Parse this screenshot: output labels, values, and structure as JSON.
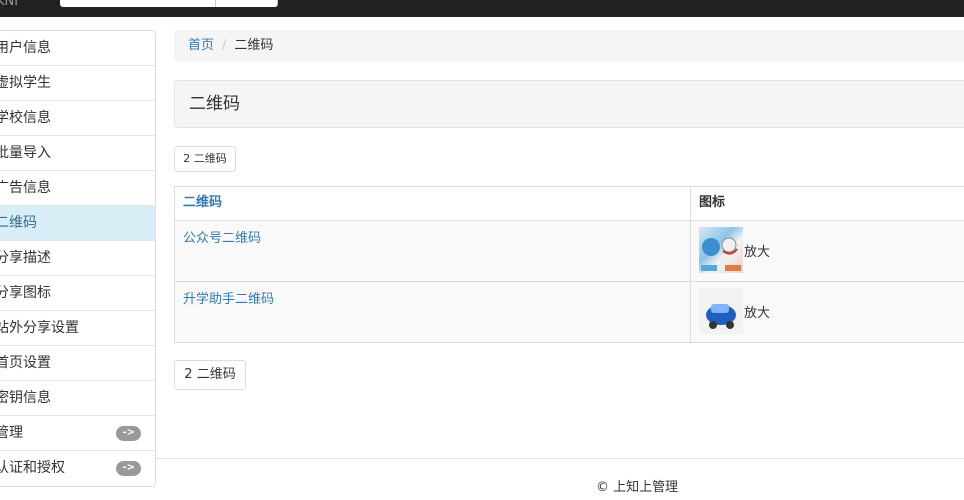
{
  "topbar": {
    "brand": "KNI"
  },
  "sidebar": {
    "items": [
      {
        "label": "用户信息"
      },
      {
        "label": "虚拟学生"
      },
      {
        "label": "学校信息"
      },
      {
        "label": "批量导入"
      },
      {
        "label": "广告信息"
      },
      {
        "label": "二维码",
        "active": true
      },
      {
        "label": "分享描述"
      },
      {
        "label": "分享图标"
      },
      {
        "label": "站外分享设置"
      },
      {
        "label": "首页设置"
      },
      {
        "label": "密钥信息"
      },
      {
        "label": "管理",
        "badge": "->"
      },
      {
        "label": "认证和授权",
        "badge": "->"
      }
    ]
  },
  "breadcrumb": {
    "home": "首页",
    "separator": "/",
    "current": "二维码"
  },
  "page_title": "二维码",
  "count_label": "2 二维码",
  "table": {
    "headers": [
      "二维码",
      "图标"
    ],
    "rows": [
      {
        "name": "公众号二维码",
        "action": "放大"
      },
      {
        "name": "升学助手二维码",
        "action": "放大"
      }
    ]
  },
  "footer": "© 上知上管理"
}
